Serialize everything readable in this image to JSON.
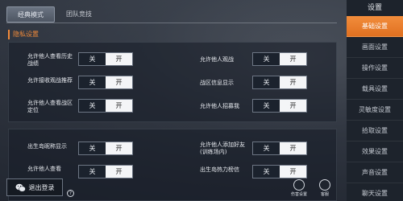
{
  "tabs": [
    "经典模式",
    "团队竞技"
  ],
  "section_title": "隐私设置",
  "toggle": {
    "off": "关",
    "on": "开"
  },
  "settings": [
    {
      "label": "允许他人查看历史战绩"
    },
    {
      "label": "允许接收观战推荐"
    },
    {
      "label": "允许他人查看战区定位"
    },
    {
      "label": "允许他人观战"
    },
    {
      "label": "战区信息显示"
    },
    {
      "label": "允许他人招募我"
    },
    {
      "label": "出生岛昵称显示"
    },
    {
      "label": "允许他人添加好友(训练场内)"
    },
    {
      "label": "允许他人查看"
    },
    {
      "label": "出生岛热力榜信"
    }
  ],
  "side_menu": {
    "title": "设置",
    "items": [
      "基础设置",
      "画面设置",
      "操作设置",
      "载具设置",
      "灵敏度设置",
      "拾取设置",
      "效果设置",
      "声音设置",
      "聊天设置"
    ]
  },
  "bottom": {
    "logout": "退出登录",
    "btn1": "伤害设置",
    "btn2": "客服"
  },
  "colors": {
    "accent": "#f08a3a",
    "side_bg": "#1d232c"
  }
}
